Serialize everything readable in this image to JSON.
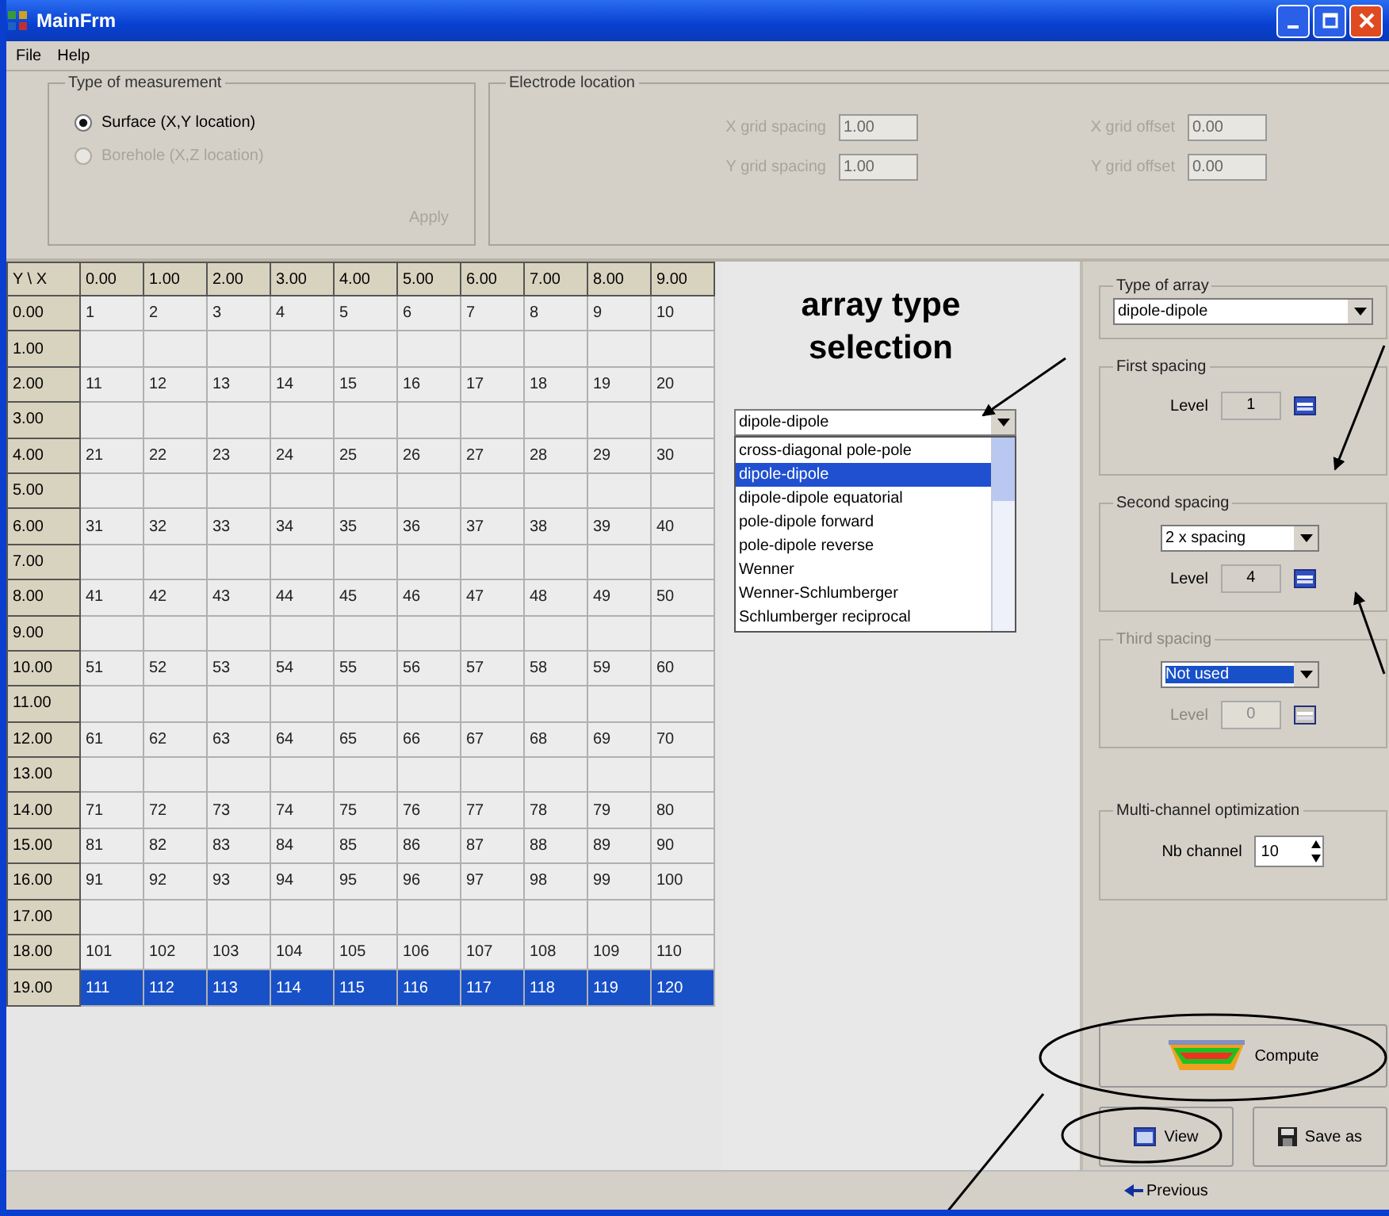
{
  "window": {
    "title": "MainFrm"
  },
  "menu": [
    {
      "label": "File"
    },
    {
      "label": "Help"
    }
  ],
  "measurement": {
    "title": "Type of measurement",
    "options": [
      {
        "label": "Surface (X,Y location)",
        "selected": true,
        "disabled": false
      },
      {
        "label": "Borehole (X,Z location)",
        "selected": false,
        "disabled": true
      }
    ],
    "apply": {
      "label": "Apply",
      "disabled": true
    }
  },
  "electrodes": {
    "title": "Electrode location",
    "disabled": true,
    "fields": [
      {
        "label": "X grid spacing",
        "value": "1.00"
      },
      {
        "label": "X grid offset",
        "value": "0.00"
      },
      {
        "label": "Y grid spacing",
        "value": "1.00"
      },
      {
        "label": "Y grid offset",
        "value": "0.00"
      }
    ]
  },
  "grid": {
    "corner": "Y \\ X",
    "columns": [
      "0.00",
      "1.00",
      "2.00",
      "3.00",
      "4.00",
      "5.00",
      "6.00",
      "7.00",
      "8.00",
      "9.00"
    ],
    "rows": [
      {
        "header": "0.00",
        "selected": false,
        "cells": [
          "1",
          "2",
          "3",
          "4",
          "5",
          "6",
          "7",
          "8",
          "9",
          "10"
        ]
      },
      {
        "header": "1.00",
        "selected": false
      },
      {
        "header": "2.00",
        "selected": false,
        "cells": [
          "11",
          "12",
          "13",
          "14",
          "15",
          "16",
          "17",
          "18",
          "19",
          "20"
        ]
      },
      {
        "header": "3.00",
        "selected": false
      },
      {
        "header": "4.00",
        "selected": false,
        "cells": [
          "21",
          "22",
          "23",
          "24",
          "25",
          "26",
          "27",
          "28",
          "29",
          "30"
        ]
      },
      {
        "header": "5.00",
        "selected": false
      },
      {
        "header": "6.00",
        "selected": false,
        "cells": [
          "31",
          "32",
          "33",
          "34",
          "35",
          "36",
          "37",
          "38",
          "39",
          "40"
        ]
      },
      {
        "header": "7.00",
        "selected": false
      },
      {
        "header": "8.00",
        "selected": false,
        "cells": [
          "41",
          "42",
          "43",
          "44",
          "45",
          "46",
          "47",
          "48",
          "49",
          "50"
        ]
      },
      {
        "header": "9.00",
        "selected": false
      },
      {
        "header": "10.00",
        "selected": false,
        "cells": [
          "51",
          "52",
          "53",
          "54",
          "55",
          "56",
          "57",
          "58",
          "59",
          "60"
        ]
      },
      {
        "header": "11.00",
        "selected": false
      },
      {
        "header": "12.00",
        "selected": false,
        "cells": [
          "61",
          "62",
          "63",
          "64",
          "65",
          "66",
          "67",
          "68",
          "69",
          "70"
        ]
      },
      {
        "header": "13.00",
        "selected": false
      },
      {
        "header": "14.00",
        "selected": false,
        "cells": [
          "71",
          "72",
          "73",
          "74",
          "75",
          "76",
          "77",
          "78",
          "79",
          "80"
        ]
      },
      {
        "header": "15.00",
        "selected": false,
        "cells": [
          "81",
          "82",
          "83",
          "84",
          "85",
          "86",
          "87",
          "88",
          "89",
          "90"
        ]
      },
      {
        "header": "16.00",
        "selected": false,
        "cells": [
          "91",
          "92",
          "93",
          "94",
          "95",
          "96",
          "97",
          "98",
          "99",
          "100"
        ]
      },
      {
        "header": "17.00",
        "selected": false
      },
      {
        "header": "18.00",
        "selected": false,
        "cells": [
          "101",
          "102",
          "103",
          "104",
          "105",
          "106",
          "107",
          "108",
          "109",
          "110"
        ]
      },
      {
        "header": "19.00",
        "selected": true,
        "cells": [
          "111",
          "112",
          "113",
          "114",
          "115",
          "116",
          "117",
          "118",
          "119",
          "120"
        ]
      }
    ]
  },
  "annotation": {
    "text": "array type selection"
  },
  "array_dropdown": {
    "value": "dipole-dipole",
    "options": [
      {
        "label": "cross-diagonal pole-pole",
        "selected": false
      },
      {
        "label": "dipole-dipole",
        "selected": true
      },
      {
        "label": "dipole-dipole equatorial",
        "selected": false
      },
      {
        "label": "pole-dipole forward",
        "selected": false
      },
      {
        "label": "pole-dipole reverse",
        "selected": false
      },
      {
        "label": "Wenner",
        "selected": false
      },
      {
        "label": "Wenner-Schlumberger",
        "selected": false
      },
      {
        "label": "Schlumberger reciprocal",
        "selected": false
      }
    ]
  },
  "type_of_array": {
    "title": "Type of array",
    "value": "dipole-dipole"
  },
  "spacings": [
    {
      "title": "First spacing",
      "level_label": "Level",
      "value": "1",
      "disabled": false
    },
    {
      "title": "Second spacing",
      "select": "2 x spacing",
      "highlighted": false,
      "level_label": "Level",
      "value": "4",
      "disabled": false
    },
    {
      "title": "Third spacing",
      "select": "Not used",
      "highlighted": true,
      "level_label": "Level",
      "value": "0",
      "disabled": true
    }
  ],
  "multichannel": {
    "title": "Multi-channel optimization",
    "label": "Nb channel",
    "value": "10"
  },
  "buttons": {
    "compute": "Compute",
    "view": "View",
    "save": "Save as",
    "previous": "Previous"
  }
}
